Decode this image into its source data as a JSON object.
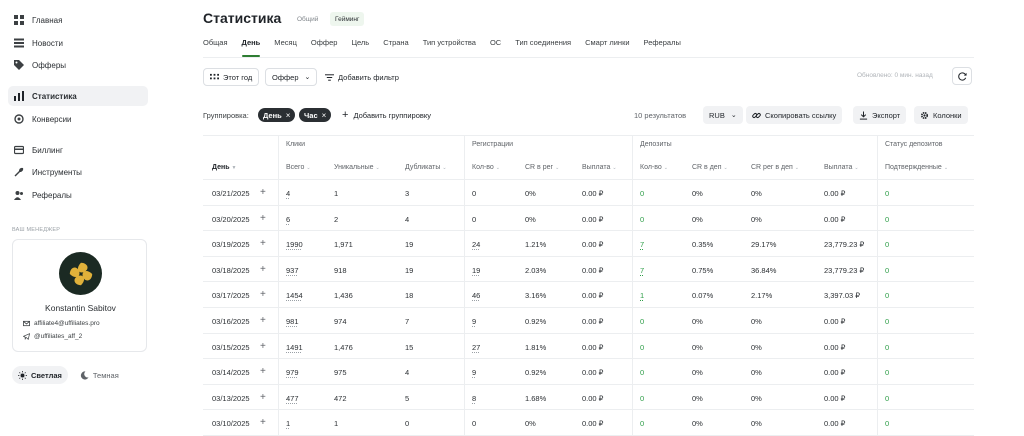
{
  "sidebar": {
    "items": [
      {
        "label": "Главная",
        "icon": "dashboard-icon"
      },
      {
        "label": "Новости",
        "icon": "news-icon"
      },
      {
        "label": "Офферы",
        "icon": "tag-icon"
      },
      {
        "label": "Статистика",
        "icon": "chart-icon"
      },
      {
        "label": "Конверсии",
        "icon": "conversion-icon"
      },
      {
        "label": "Биллинг",
        "icon": "card-icon"
      },
      {
        "label": "Инструменты",
        "icon": "wrench-icon"
      },
      {
        "label": "Рефералы",
        "icon": "users-icon"
      }
    ],
    "manager_label": "ВАШ МЕНЕДЖЕР",
    "manager": {
      "name": "Konstantin Sabitov",
      "email": "affiliate4@uffiliates.pro",
      "telegram": "@uffiliates_aff_2"
    },
    "theme": {
      "light": "Светлая",
      "dark": "Темная"
    }
  },
  "header": {
    "title": "Статистика",
    "title_tabs": [
      "Общий",
      "Гейминг"
    ]
  },
  "tabs": [
    "Общая",
    "День",
    "Месяц",
    "Оффер",
    "Цель",
    "Страна",
    "Тип устройства",
    "ОС",
    "Тип соединения",
    "Смарт линки",
    "Рефералы"
  ],
  "toolbar": {
    "period": "Этот год",
    "offer": "Оффер",
    "add_filter": "Добавить фильтр",
    "updated": "Обновлено: 0 мин. назад"
  },
  "grouping": {
    "label": "Группировка:",
    "chips": [
      "День",
      "Час"
    ],
    "add": "Добавить группировку",
    "results": "10  результатов",
    "currency": "RUB",
    "copy_link": "Скопировать ссылку",
    "export": "Экспорт",
    "columns": "Колонки"
  },
  "table": {
    "groups": [
      "Клики",
      "Регистрации",
      "Депозиты",
      "Статус депозитов"
    ],
    "columns": [
      "День",
      "Всего",
      "Уникальные",
      "Дубликаты",
      "Кол-во",
      "CR в рег",
      "Выплата",
      "Кол-во",
      "CR в деп",
      "CR рег в деп",
      "Выплата",
      "Подтвержденные"
    ],
    "rows": [
      [
        "03/21/2025",
        "4",
        "1",
        "3",
        "0",
        "0%",
        "0.00 ₽",
        "0",
        "0%",
        "0%",
        "0.00 ₽",
        "0"
      ],
      [
        "03/20/2025",
        "6",
        "2",
        "4",
        "0",
        "0%",
        "0.00 ₽",
        "0",
        "0%",
        "0%",
        "0.00 ₽",
        "0"
      ],
      [
        "03/19/2025",
        "1990",
        "1,971",
        "19",
        "24",
        "1.21%",
        "0.00 ₽",
        "7",
        "0.35%",
        "29.17%",
        "23,779.23 ₽",
        "0"
      ],
      [
        "03/18/2025",
        "937",
        "918",
        "19",
        "19",
        "2.03%",
        "0.00 ₽",
        "7",
        "0.75%",
        "36.84%",
        "23,779.23 ₽",
        "0"
      ],
      [
        "03/17/2025",
        "1454",
        "1,436",
        "18",
        "46",
        "3.16%",
        "0.00 ₽",
        "1",
        "0.07%",
        "2.17%",
        "3,397.03 ₽",
        "0"
      ],
      [
        "03/16/2025",
        "981",
        "974",
        "7",
        "9",
        "0.92%",
        "0.00 ₽",
        "0",
        "0%",
        "0%",
        "0.00 ₽",
        "0"
      ],
      [
        "03/15/2025",
        "1491",
        "1,476",
        "15",
        "27",
        "1.81%",
        "0.00 ₽",
        "0",
        "0%",
        "0%",
        "0.00 ₽",
        "0"
      ],
      [
        "03/14/2025",
        "979",
        "975",
        "4",
        "9",
        "0.92%",
        "0.00 ₽",
        "0",
        "0%",
        "0%",
        "0.00 ₽",
        "0"
      ],
      [
        "03/13/2025",
        "477",
        "472",
        "5",
        "8",
        "1.68%",
        "0.00 ₽",
        "0",
        "0%",
        "0%",
        "0.00 ₽",
        "0"
      ],
      [
        "03/10/2025",
        "1",
        "1",
        "0",
        "0",
        "0%",
        "0.00 ₽",
        "0",
        "0%",
        "0%",
        "0.00 ₽",
        "0"
      ]
    ]
  },
  "colors": {
    "accent": "#2e7d32",
    "positive": "#2e9e48"
  }
}
